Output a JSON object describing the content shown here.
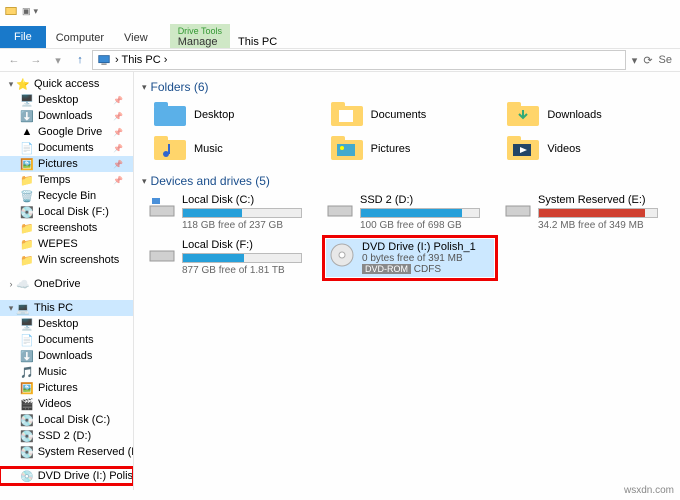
{
  "window": {
    "title": "This PC"
  },
  "ribbon": {
    "tabs": {
      "file": "File",
      "computer": "Computer",
      "view": "View"
    },
    "context": {
      "group": "Drive Tools",
      "tab": "Manage"
    }
  },
  "breadcrumb": {
    "text": "This PC"
  },
  "sidebar": {
    "quick_access": "Quick access",
    "qa_items": [
      {
        "label": "Desktop"
      },
      {
        "label": "Downloads"
      },
      {
        "label": "Google Drive"
      },
      {
        "label": "Documents"
      },
      {
        "label": "Pictures"
      },
      {
        "label": "Temps"
      },
      {
        "label": "Recycle Bin"
      },
      {
        "label": "Local Disk (F:)"
      },
      {
        "label": "screenshots"
      },
      {
        "label": "WEPES"
      },
      {
        "label": "Win screenshots"
      }
    ],
    "onedrive": "OneDrive",
    "this_pc": "This PC",
    "pc_items": [
      {
        "label": "Desktop"
      },
      {
        "label": "Documents"
      },
      {
        "label": "Downloads"
      },
      {
        "label": "Music"
      },
      {
        "label": "Pictures"
      },
      {
        "label": "Videos"
      },
      {
        "label": "Local Disk (C:)"
      },
      {
        "label": "SSD 2 (D:)"
      },
      {
        "label": "System Reserved (E:)"
      }
    ],
    "dvd": "DVD Drive (I:) Polish"
  },
  "content": {
    "folders_hdr": "Folders (6)",
    "folders": [
      {
        "label": "Desktop"
      },
      {
        "label": "Documents"
      },
      {
        "label": "Downloads"
      },
      {
        "label": "Music"
      },
      {
        "label": "Pictures"
      },
      {
        "label": "Videos"
      }
    ],
    "drives_hdr": "Devices and drives (5)",
    "drives": [
      {
        "name": "Local Disk (C:)",
        "free": "118 GB free of 237 GB",
        "fill_pct": 50
      },
      {
        "name": "SSD 2 (D:)",
        "free": "100 GB free of 698 GB",
        "fill_pct": 86
      },
      {
        "name": "System Reserved (E:)",
        "free": "34.2 MB free of 349 MB",
        "fill_pct": 90
      },
      {
        "name": "Local Disk (F:)",
        "free": "877 GB free of 1.81 TB",
        "fill_pct": 52
      }
    ],
    "dvd": {
      "name": "DVD Drive (I:) Polish_1",
      "free": "0 bytes free of 391 MB",
      "tag": "DVD-ROM",
      "fs": "CDFS"
    }
  },
  "attrib": "wsxdn.com"
}
